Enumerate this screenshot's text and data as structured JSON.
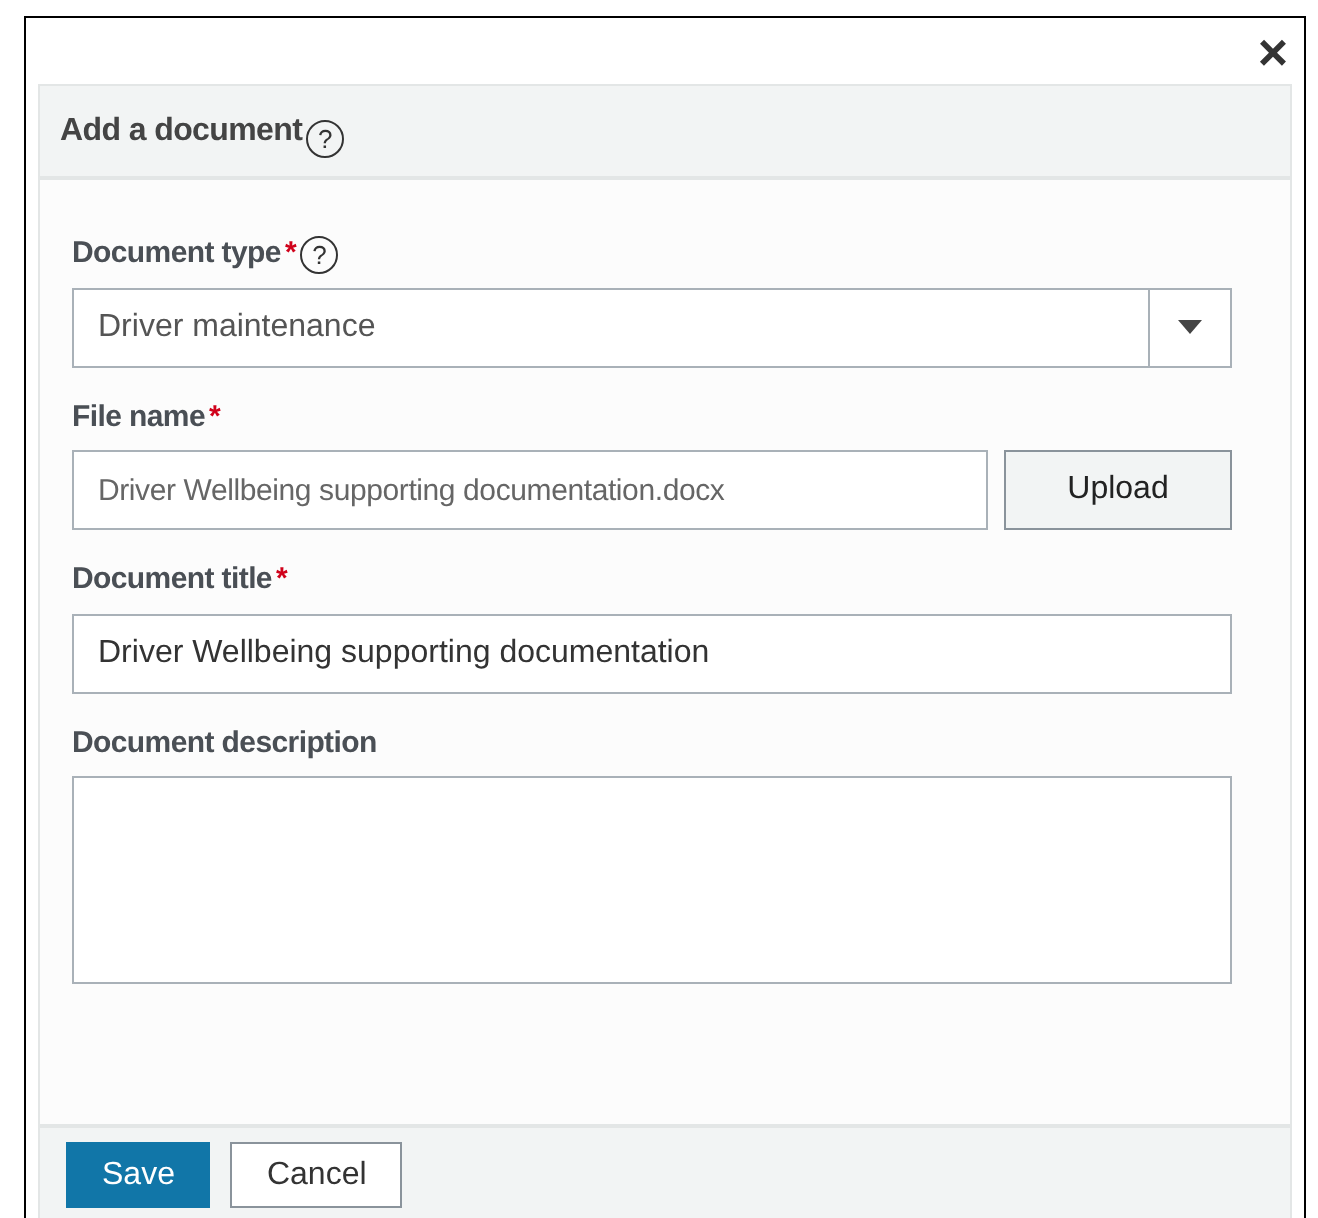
{
  "dialog": {
    "close": "×",
    "title": "Add a document",
    "help": "?"
  },
  "fields": [
    {
      "kind": "select",
      "label": "Document type",
      "required_mark": "*",
      "help": "?",
      "value": "Driver maintenance"
    },
    {
      "kind": "file",
      "label": "File name",
      "required_mark": "*",
      "value": "Driver Wellbeing supporting documentation.docx",
      "button": "Upload"
    },
    {
      "kind": "text",
      "label": "Document title",
      "required_mark": "*",
      "value": "Driver Wellbeing supporting documentation"
    },
    {
      "kind": "textarea",
      "label": "Document description"
    }
  ],
  "buttons": [
    {
      "label": "Save",
      "kind": "primary"
    },
    {
      "label": "Cancel",
      "kind": "secondary"
    }
  ]
}
